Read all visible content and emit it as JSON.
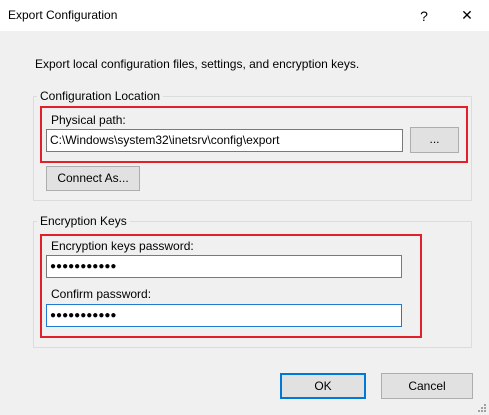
{
  "window": {
    "title": "Export Configuration",
    "help_glyph": "?",
    "close_glyph": "✕"
  },
  "description": "Export local configuration files, settings, and encryption keys.",
  "config_location": {
    "legend": "Configuration Location",
    "path_label": "Physical path:",
    "path_value": "C:\\Windows\\system32\\inetsrv\\config\\export",
    "browse_label": "...",
    "connect_label": "Connect As..."
  },
  "encryption": {
    "legend": "Encryption Keys",
    "password_label": "Encryption keys password:",
    "password_value": "●●●●●●●●●●●",
    "confirm_label": "Confirm password:",
    "confirm_value": "●●●●●●●●●●●"
  },
  "footer": {
    "ok_label": "OK",
    "cancel_label": "Cancel"
  },
  "colors": {
    "highlight": "#e1202a",
    "focus": "#1f7ad1"
  }
}
